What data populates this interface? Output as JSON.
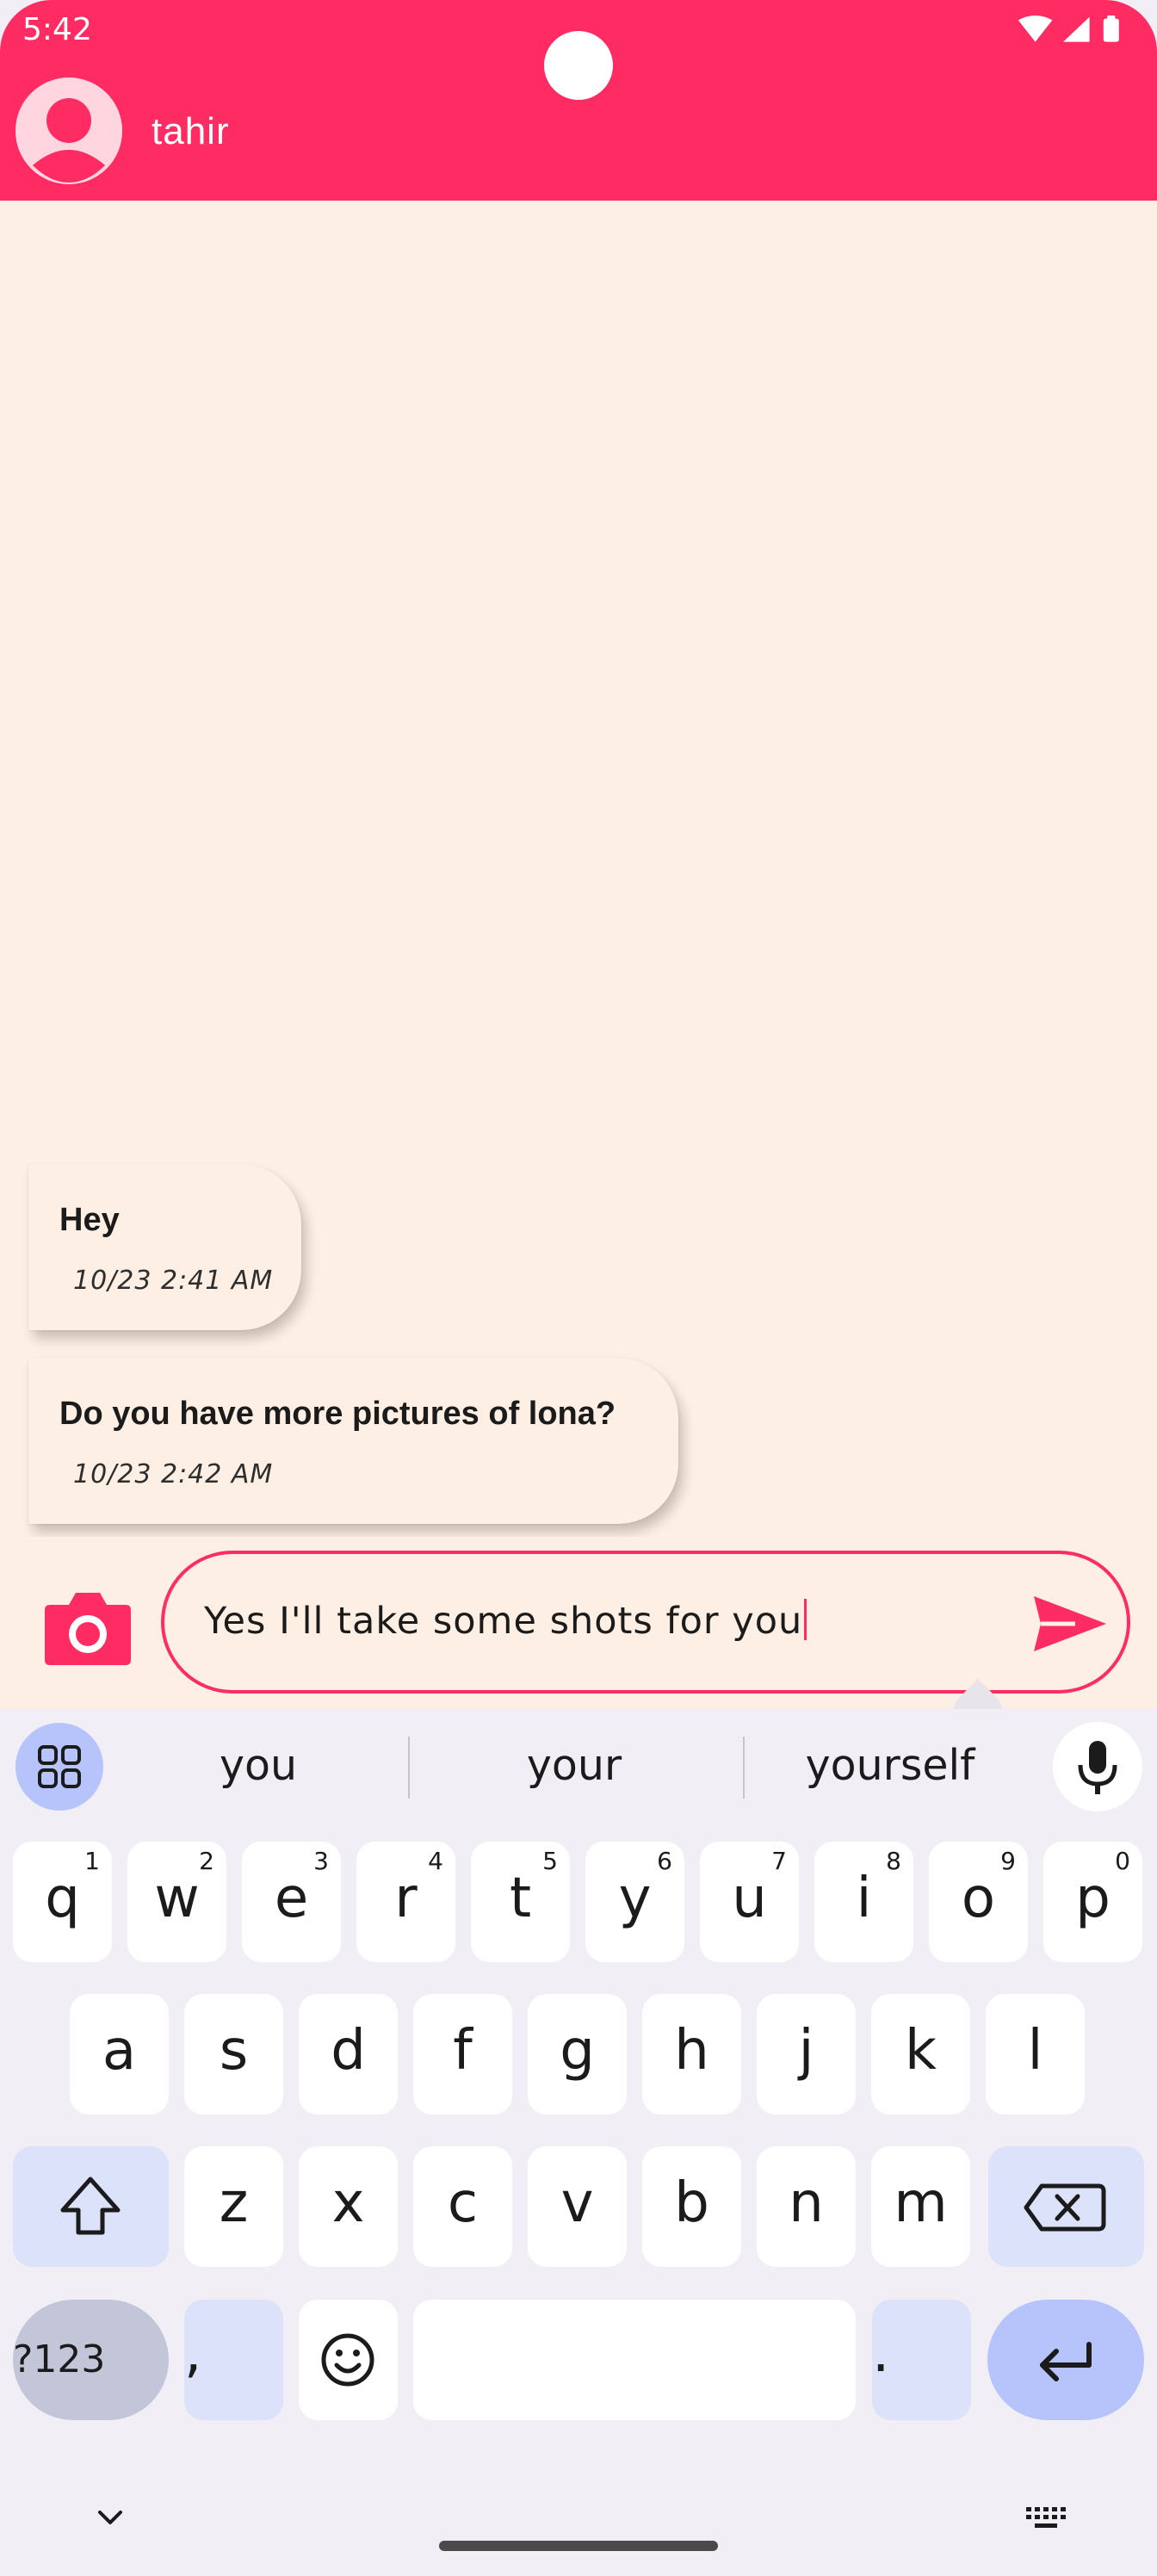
{
  "status_bar": {
    "time": "5:42",
    "icons": [
      "wifi-icon",
      "signal-icon",
      "battery-icon"
    ]
  },
  "header": {
    "contact_name": "tahir",
    "background_color": "#fe2c62"
  },
  "messages": [
    {
      "text": "Hey",
      "timestamp": "10/23 2:41 AM"
    },
    {
      "text": "Do you have more pictures of lona?",
      "timestamp": "10/23 2:42 AM"
    }
  ],
  "composer": {
    "input_value": "Yes I'll take some shots for you",
    "accent_color": "#fe2c62"
  },
  "keyboard": {
    "suggestions": [
      "you",
      "your",
      "yourself"
    ],
    "row1": [
      {
        "letter": "q",
        "hint": "1"
      },
      {
        "letter": "w",
        "hint": "2"
      },
      {
        "letter": "e",
        "hint": "3"
      },
      {
        "letter": "r",
        "hint": "4"
      },
      {
        "letter": "t",
        "hint": "5"
      },
      {
        "letter": "y",
        "hint": "6"
      },
      {
        "letter": "u",
        "hint": "7"
      },
      {
        "letter": "i",
        "hint": "8"
      },
      {
        "letter": "o",
        "hint": "9"
      },
      {
        "letter": "p",
        "hint": "0"
      }
    ],
    "row2": [
      "a",
      "s",
      "d",
      "f",
      "g",
      "h",
      "j",
      "k",
      "l"
    ],
    "row3": [
      "z",
      "x",
      "c",
      "v",
      "b",
      "n",
      "m"
    ],
    "symbols_label": "?123",
    "comma_label": ",",
    "period_label": "."
  }
}
